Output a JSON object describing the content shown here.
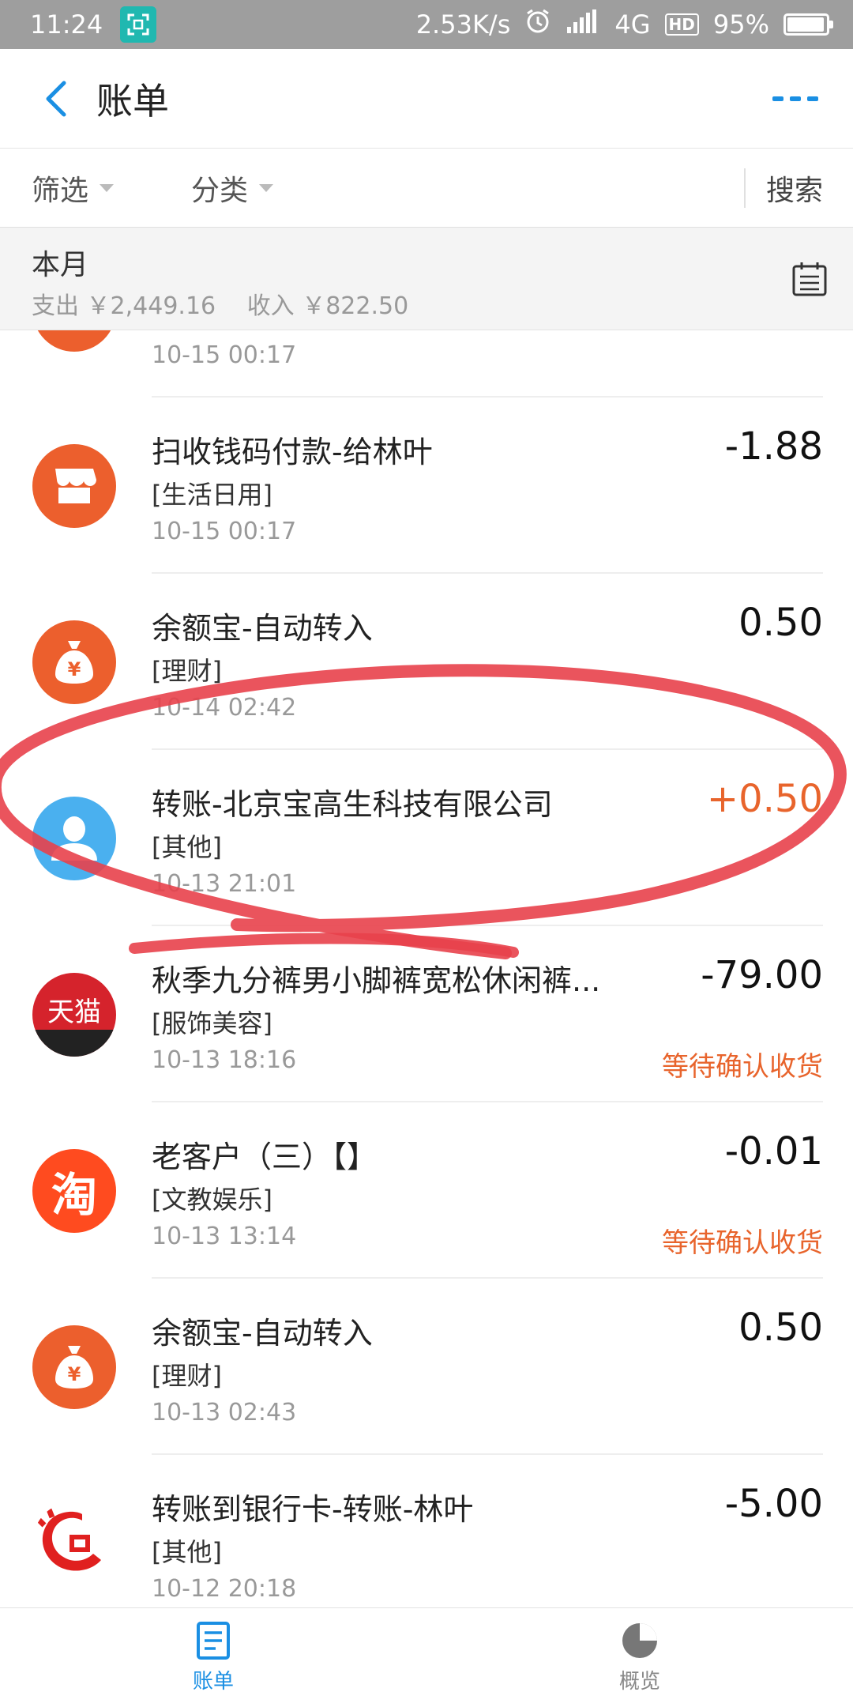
{
  "status_bar": {
    "time": "11:24",
    "speed": "2.53K/s",
    "network": "4G",
    "hd": "HD",
    "battery": "95%",
    "battery_level": 0.95
  },
  "header": {
    "title": "账单"
  },
  "filters": {
    "filter_label": "筛选",
    "category_label": "分类",
    "search_label": "搜索"
  },
  "summary": {
    "period": "本月",
    "expense": "支出 ￥2,449.16",
    "income": "收入 ￥822.50"
  },
  "transactions": [
    {
      "name": "",
      "category": "",
      "time": "10-15  00:17",
      "amount": "",
      "status": "",
      "icon": "orange-circle-icon"
    },
    {
      "name": "扫收钱码付款-给林叶",
      "category": "[生活日用]",
      "time": "10-15  00:17",
      "amount": "-1.88",
      "status": "",
      "icon": "shop-icon"
    },
    {
      "name": "余额宝-自动转入",
      "category": "[理财]",
      "time": "10-14  02:42",
      "amount": "0.50",
      "status": "",
      "icon": "money-bag-icon"
    },
    {
      "name": "转账-北京宝高生科技有限公司",
      "category": "[其他]",
      "time": "10-13  21:01",
      "amount": "+0.50",
      "status": "",
      "icon": "user-avatar-icon"
    },
    {
      "name": "秋季九分裤男小脚裤宽松休闲裤...",
      "category": "[服饰美容]",
      "time": "10-13  18:16",
      "amount": "-79.00",
      "status": "等待确认收货",
      "icon": "tmall-icon",
      "icon_text": "天猫"
    },
    {
      "name": "老客户（三）【】",
      "category": "[文教娱乐]",
      "time": "10-13  13:14",
      "amount": "-0.01",
      "status": "等待确认收货",
      "icon": "taobao-icon",
      "icon_text": "淘"
    },
    {
      "name": "余额宝-自动转入",
      "category": "[理财]",
      "time": "10-13  02:43",
      "amount": "0.50",
      "status": "",
      "icon": "money-bag-icon"
    },
    {
      "name": "转账到银行卡-转账-林叶",
      "category": "[其他]",
      "time": "10-12  20:18",
      "amount": "-5.00",
      "status": "",
      "icon": "bank-logo-icon"
    }
  ],
  "tabbar": {
    "bill_label": "账单",
    "overview_label": "概览"
  },
  "colors": {
    "accent": "#1a8fe3",
    "income": "#e8642c",
    "annotation": "#e8414b"
  }
}
